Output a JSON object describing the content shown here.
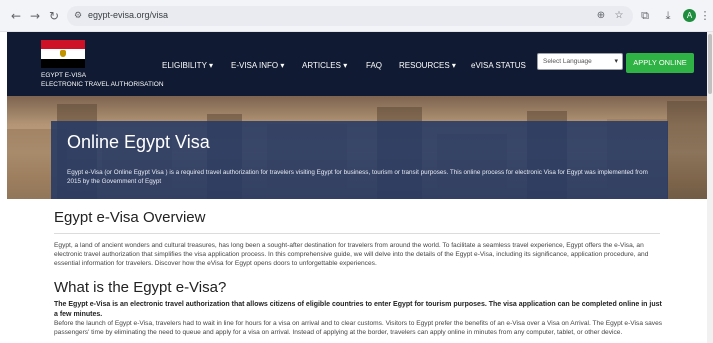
{
  "browser": {
    "url": "egypt-evisa.org/visa",
    "profile_initial": "A",
    "back_icon": "arrow-left-icon",
    "forward_icon": "arrow-right-icon",
    "reload_icon": "reload-icon"
  },
  "header": {
    "brand_line1": "EGYPT E-VISA",
    "brand_line2": "ELECTRONIC TRAVEL AUTHORISATION",
    "menu": [
      {
        "label": "ELIGIBILITY ▾"
      },
      {
        "label": "E-VISA INFO ▾"
      },
      {
        "label": "ARTICLES ▾"
      },
      {
        "label": "FAQ"
      },
      {
        "label": "RESOURCES ▾"
      },
      {
        "label": "eVISA STATUS"
      }
    ],
    "language_select": {
      "selected": "Select Language"
    },
    "apply_label": "APPLY ONLINE",
    "colors": {
      "header_bg": "#101b33",
      "apply_green": "#2fb344",
      "hero_panel": "#253964"
    }
  },
  "hero": {
    "title": "Online Egypt Visa",
    "subtitle": "Egypt e-Visa (or Online Egypt Visa ) is a required travel authorization for travelers visiting Egypt for business, tourism or transit purposes. This online process for electronic Visa for Egypt was implemented from 2015 by the Government of Egypt"
  },
  "content": {
    "overview_heading": "Egypt e-Visa Overview",
    "overview_text": "Egypt, a land of ancient wonders and cultural treasures, has long been a sought-after destination for travelers from around the world. To facilitate a seamless travel experience, Egypt offers the e-Visa, an electronic travel authorization that simplifies the visa application process. In this comprehensive guide, we will delve into the details of the Egypt e-Visa, including its significance, application procedure, and essential information for travelers. Discover how the eVisa for Egypt opens doors to unforgettable experiences.",
    "what_heading": "What is the Egypt e-Visa?",
    "what_bold": "The Egypt e-Visa is an electronic travel authorization that allows citizens of eligible countries to enter Egypt for tourism purposes. The visa application can be completed online in just a few minutes.",
    "what_text": "Before the launch of Egypt e-Visa, travelers had to wait in line for hours for a visa on arrival and to clear customs. Visitors to Egypt prefer the benefits of an e-Visa over a Visa on Arrival. The Egypt e-Visa saves passengers' time by eliminating the need to queue and apply for a visa on arrival. Instead of applying at the border, travelers can apply online in minutes from any computer, tablet, or other device."
  }
}
